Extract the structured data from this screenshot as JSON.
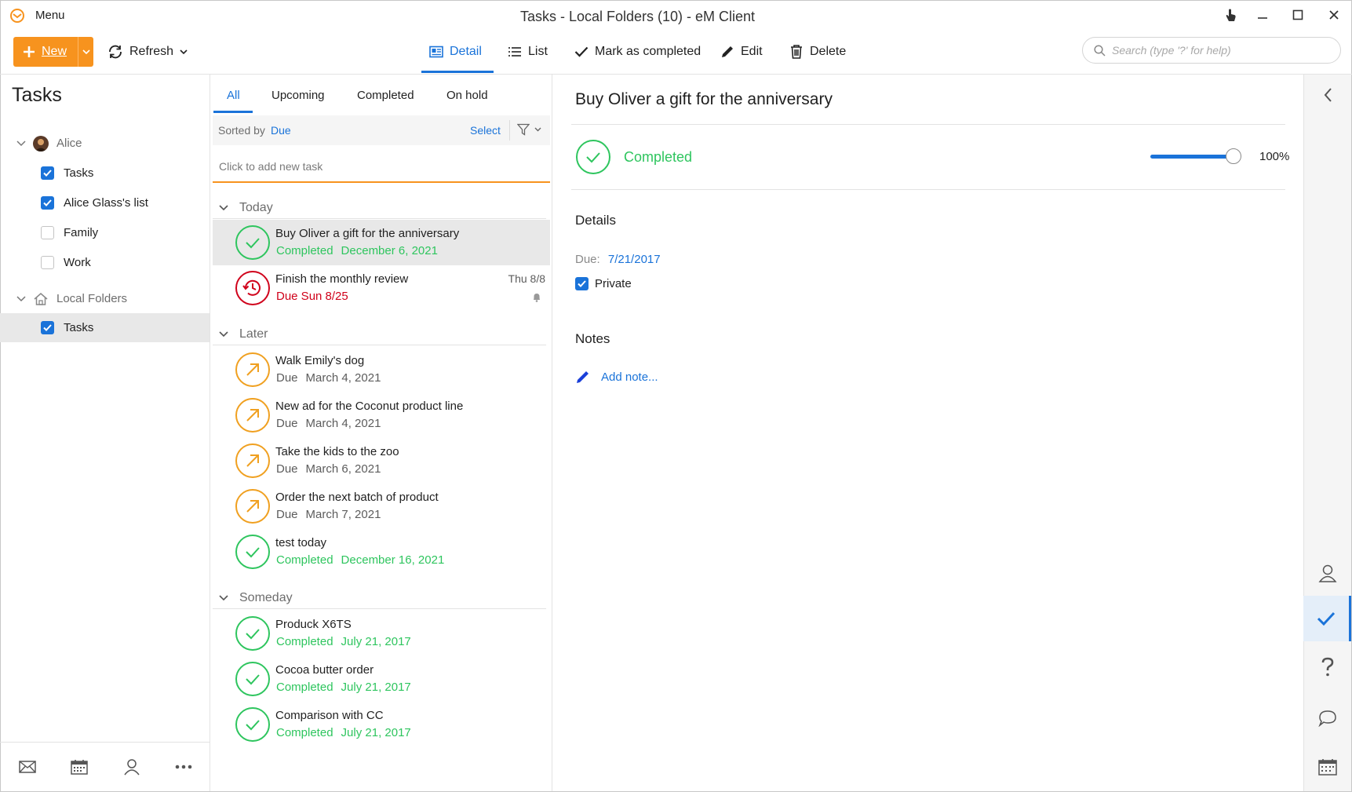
{
  "app": {
    "menu_label": "Menu",
    "window_title": "Tasks - Local Folders (10) - eM Client"
  },
  "toolbar": {
    "new_label": "New",
    "refresh_label": "Refresh",
    "detail_label": "Detail",
    "list_label": "List",
    "mark_completed_label": "Mark as completed",
    "edit_label": "Edit",
    "delete_label": "Delete",
    "search_placeholder": "Search (type '?' for help)"
  },
  "sidebar": {
    "title": "Tasks",
    "accounts": [
      {
        "name": "Alice",
        "items": [
          {
            "label": "Tasks",
            "checked": true
          },
          {
            "label": "Alice Glass's list",
            "checked": true
          },
          {
            "label": "Family",
            "checked": false
          },
          {
            "label": "Work",
            "checked": false
          }
        ]
      },
      {
        "name": "Local Folders",
        "items": [
          {
            "label": "Tasks",
            "checked": true,
            "selected": true
          }
        ]
      }
    ],
    "bottom_nav": [
      "mail-icon",
      "calendar-icon",
      "contacts-icon",
      "more-icon"
    ]
  },
  "task_list": {
    "tabs": [
      "All",
      "Upcoming",
      "Completed",
      "On hold"
    ],
    "active_tab": "All",
    "sorted_by_label": "Sorted by",
    "sorted_by_value": "Due",
    "select_label": "Select",
    "add_task_placeholder": "Click to add new task",
    "groups": [
      {
        "name": "Today",
        "tasks": [
          {
            "title": "Buy Oliver a gift for the anniversary",
            "status": "Completed",
            "date": "December 6, 2021",
            "state": "completed",
            "selected": true
          },
          {
            "title": "Finish the monthly review",
            "status": "Due Sun 8/25",
            "date": "",
            "state": "overdue",
            "right": "Thu 8/8",
            "reminder": true
          }
        ]
      },
      {
        "name": "Later",
        "tasks": [
          {
            "title": "Walk Emily's dog",
            "status": "Due",
            "date": "March 4, 2021",
            "state": "upcoming"
          },
          {
            "title": "New ad for the Coconut product line",
            "status": "Due",
            "date": "March 4, 2021",
            "state": "upcoming"
          },
          {
            "title": "Take the kids to the zoo",
            "status": "Due",
            "date": "March 6, 2021",
            "state": "upcoming"
          },
          {
            "title": "Order the next batch of product",
            "status": "Due",
            "date": "March 7, 2021",
            "state": "upcoming"
          },
          {
            "title": "test today",
            "status": "Completed",
            "date": "December 16, 2021",
            "state": "completed"
          }
        ]
      },
      {
        "name": "Someday",
        "tasks": [
          {
            "title": "Produck X6TS",
            "status": "Completed",
            "date": "July 21, 2017",
            "state": "completed"
          },
          {
            "title": "Cocoa butter order",
            "status": "Completed",
            "date": "July 21, 2017",
            "state": "completed"
          },
          {
            "title": "Comparison with CC",
            "status": "Completed",
            "date": "July 21, 2017",
            "state": "completed"
          }
        ]
      }
    ]
  },
  "detail": {
    "title": "Buy Oliver a gift for the anniversary",
    "status": "Completed",
    "progress_percent": 100,
    "progress_label": "100%",
    "details_heading": "Details",
    "due_label": "Due:",
    "due_value": "7/21/2017",
    "private_label": "Private",
    "private_checked": true,
    "notes_heading": "Notes",
    "add_note_label": "Add note..."
  },
  "colors": {
    "accent": "#1a73d9",
    "new_button": "#f7931e",
    "completed": "#2ec55e",
    "overdue": "#d0021b",
    "upcoming": "#f0a020"
  }
}
